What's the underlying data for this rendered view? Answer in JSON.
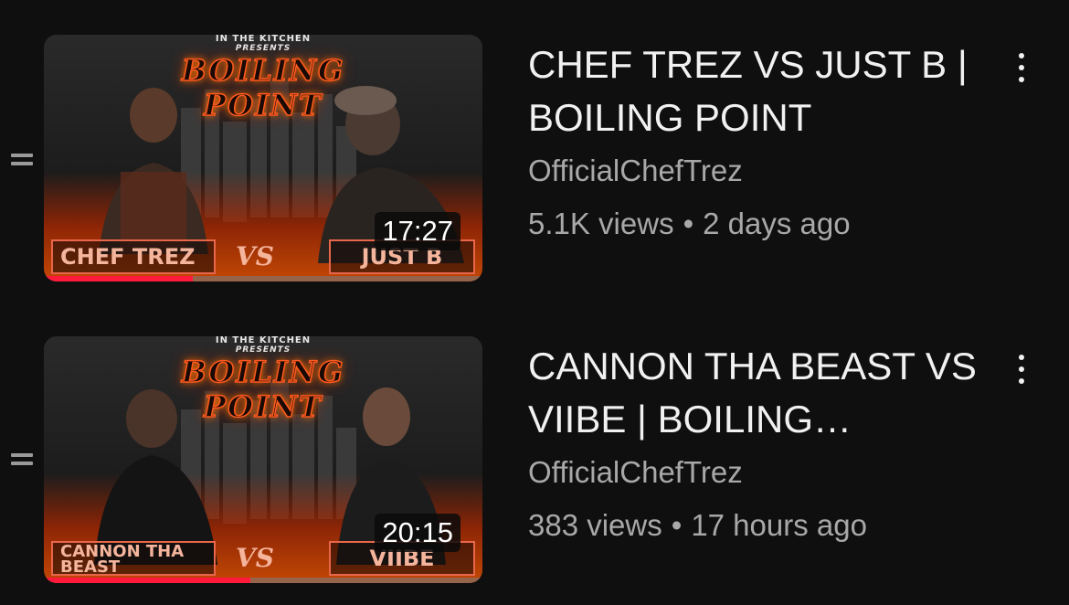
{
  "videos": [
    {
      "title": "CHEF TREZ VS JUST B | BOILING POINT",
      "channel": "OfficialChefTrez",
      "views": "5.1K views",
      "separator": "•",
      "age": "2 days ago",
      "duration": "17:27",
      "watched_fraction": 0.34,
      "thumbnail": {
        "top_text": "IN THE KITCHEN",
        "presents": "PRESENTS",
        "brand": "BOILING POINT",
        "left_name": "CHEF TREZ",
        "vs": "VS",
        "right_name": "JUST B"
      }
    },
    {
      "title": "CANNON THA BEAST VS VIIBE | BOILING…",
      "channel": "OfficialChefTrez",
      "views": "383 views",
      "separator": "•",
      "age": "17 hours ago",
      "duration": "20:15",
      "watched_fraction": 0.47,
      "thumbnail": {
        "top_text": "IN THE KITCHEN",
        "presents": "PRESENTS",
        "brand": "BOILING POINT",
        "left_name": "CANNON THA BEAST",
        "vs": "VS",
        "right_name": "VIIBE"
      }
    }
  ],
  "icons": {
    "drag": "drag-handle-icon",
    "menu": "more-vertical-icon"
  },
  "colors": {
    "background": "#0f0f0f",
    "text_primary": "#f1f1f1",
    "text_secondary": "#a8a8a8",
    "progress": "#ff1a3c",
    "thumbnail_accent": "#e8664a"
  }
}
